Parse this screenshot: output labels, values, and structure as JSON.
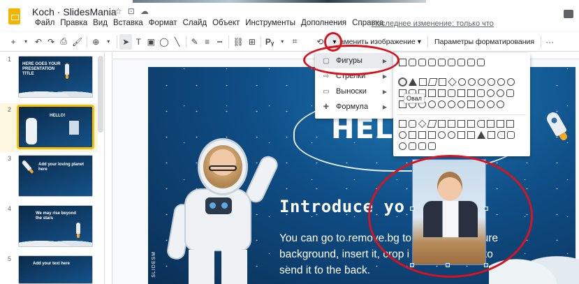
{
  "app": {
    "doc_title": "Koch · SlidesMania",
    "last_edit": "Последнее изменение: только что"
  },
  "menubar": [
    "Файл",
    "Правка",
    "Вид",
    "Вставка",
    "Формат",
    "Слайд",
    "Объект",
    "Инструменты",
    "Дополнения",
    "Справка"
  ],
  "toolbar": {
    "replace_image_label": "Заменить изображение",
    "format_options_label": "Параметры форматирования",
    "more_label": "···"
  },
  "slides": [
    {
      "num": "1",
      "title": "HERE GOES YOUR PRESENTATION TITLE"
    },
    {
      "num": "2",
      "title": "HELLO!"
    },
    {
      "num": "3",
      "title": "Add your loving planet here"
    },
    {
      "num": "4",
      "title": "We may rise beyond the stars"
    },
    {
      "num": "5",
      "title": "Add your text here"
    }
  ],
  "slide": {
    "hello": "HELL",
    "introduce": "Introduce yo",
    "body_line1": "You can go to remove.bg to                  picture",
    "body_line2": "background, insert it, crop i               , on it to",
    "body_line3": "send it to the back.",
    "side_text": "SLIDESM"
  },
  "mask_menu": {
    "items": [
      {
        "label": "Фигуры",
        "icon": "square-icon"
      },
      {
        "label": "Стрелки",
        "icon": "arrow-right-icon"
      },
      {
        "label": "Выноски",
        "icon": "callout-icon"
      },
      {
        "label": "Формула",
        "icon": "plus-icon"
      }
    ]
  },
  "shapes_tooltip": "Овал",
  "colors": {
    "accent": "#1a73e8",
    "annotation_red": "#d8131e",
    "slide_bg": "#0f4e86",
    "logo": "#f4b400"
  }
}
